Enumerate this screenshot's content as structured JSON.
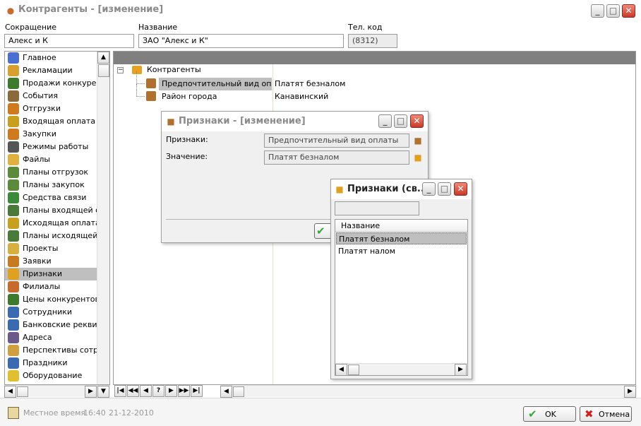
{
  "window": {
    "title": "Контрагенты - [изменение]",
    "header": {
      "short_label": "Сокращение",
      "short_value": "Алекс и К",
      "name_label": "Название",
      "name_value": "ЗАО \"Алекс и К\"",
      "phone_label": "Тел. код",
      "phone_value": "(8312)"
    }
  },
  "sidebar": {
    "items": [
      {
        "label": "Главное",
        "icon": "document-icon",
        "color": "#4a6fd0"
      },
      {
        "label": "Рекламации",
        "icon": "pencil-note-icon",
        "color": "#d8a030"
      },
      {
        "label": "Продажи конкурентов",
        "icon": "coins-icon",
        "color": "#3d7a2e"
      },
      {
        "label": "События",
        "icon": "calendar-icon",
        "color": "#8a6a3a"
      },
      {
        "label": "Отгрузки",
        "icon": "truck-icon",
        "color": "#d07a20"
      },
      {
        "label": "Входящая оплата",
        "icon": "money-in-icon",
        "color": "#c8a020"
      },
      {
        "label": "Закупки",
        "icon": "cart-icon",
        "color": "#d07a20"
      },
      {
        "label": "Режимы работы",
        "icon": "clock-icon",
        "color": "#555555"
      },
      {
        "label": "Файлы",
        "icon": "folder-icon",
        "color": "#e0b040"
      },
      {
        "label": "Планы отгрузок",
        "icon": "plan-up-icon",
        "color": "#5a8a3a"
      },
      {
        "label": "Планы закупок",
        "icon": "plan-down-icon",
        "color": "#5a8a3a"
      },
      {
        "label": "Средства связи",
        "icon": "phone-icon",
        "color": "#3a8a3a"
      },
      {
        "label": "Планы входящей оплаты",
        "icon": "money-plan-icon",
        "color": "#4a7a3a"
      },
      {
        "label": "Исходящая оплата",
        "icon": "money-out-icon",
        "color": "#c8a020"
      },
      {
        "label": "Планы исходящей оплаты",
        "icon": "money-plan-out-icon",
        "color": "#4a7a3a"
      },
      {
        "label": "Проекты",
        "icon": "project-icon",
        "color": "#d8b040"
      },
      {
        "label": "Заявки",
        "icon": "request-icon",
        "color": "#c87a20"
      },
      {
        "label": "Признаки",
        "icon": "cube-icon",
        "color": "#e0a020"
      },
      {
        "label": "Филиалы",
        "icon": "person-icon",
        "color": "#c86a30"
      },
      {
        "label": "Цены конкурентов",
        "icon": "price-icon",
        "color": "#3d7a2e"
      },
      {
        "label": "Сотрудники",
        "icon": "people-icon",
        "color": "#3a6ab0"
      },
      {
        "label": "Банковские реквизиты",
        "icon": "bank-icon",
        "color": "#3a6ab0"
      },
      {
        "label": "Адреса",
        "icon": "address-icon",
        "color": "#6a5a8a"
      },
      {
        "label": "Перспективы сотрудничества",
        "icon": "handshake-icon",
        "color": "#d0a040"
      },
      {
        "label": "Праздники",
        "icon": "holiday-calendar-icon",
        "color": "#3a6ab0"
      },
      {
        "label": "Оборудование",
        "icon": "equipment-icon",
        "color": "#e0c030"
      }
    ],
    "selected_index": 17
  },
  "tree": {
    "root": "Контрагенты",
    "rows": [
      {
        "name": "Предпочтительный вид оплаты",
        "value": "Платят безналом"
      },
      {
        "name": "Район города",
        "value": "Канавинский"
      }
    ],
    "navigator": [
      "|◀",
      "◀◀",
      "◀",
      "?",
      "▶",
      "▶▶",
      "▶|"
    ]
  },
  "dialog_attr": {
    "title": "Признаки - [изменение]",
    "attr_label": "Признаки:",
    "attr_value": "Предпочтительный вид оплаты",
    "value_label": "Значение:",
    "value_value": "Платят безналом"
  },
  "dialog_pick": {
    "title": "Признаки (св...",
    "filter_value": "",
    "column_header": "Название",
    "items": [
      "Платят безналом",
      "Платят налом"
    ],
    "selected_index": 0
  },
  "status": {
    "local_time_label": "Местное время",
    "time": "16:40",
    "date": "21-12-2010"
  },
  "buttons": {
    "ok": "OK",
    "cancel": "Отмена"
  },
  "colors": {
    "selection": "#bfbfbf",
    "grid_header": "#7f7f7f",
    "ok_check": "#3aa53a",
    "cancel_x": "#d02020"
  }
}
